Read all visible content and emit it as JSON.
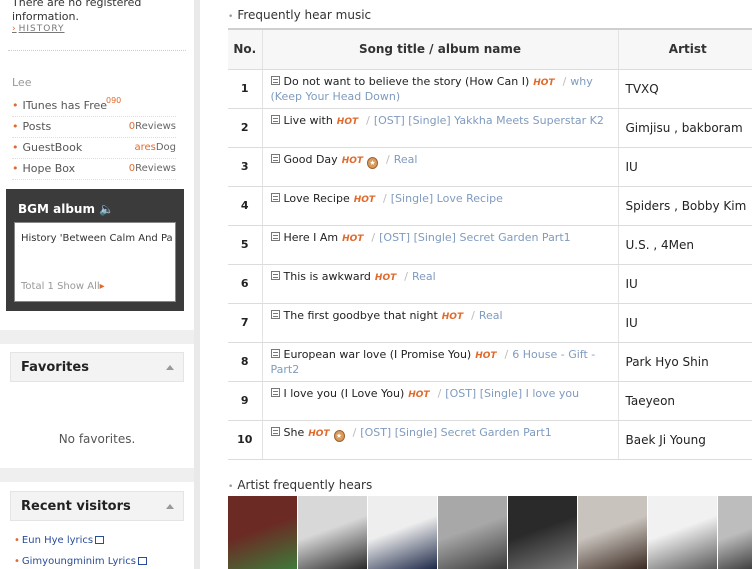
{
  "sidebar": {
    "notice": "There are no registered information.",
    "history_link": "HISTORY",
    "owner": "Lee",
    "menu": [
      {
        "label": "ITunes has Free",
        "count_prefix": "",
        "count_word": "",
        "overflow": "090"
      },
      {
        "label": "Posts",
        "count_prefix": "0",
        "count_word": "Reviews"
      },
      {
        "label": "GuestBook",
        "count_prefix": "ares",
        "count_word": "Dog"
      },
      {
        "label": "Hope Box",
        "count_prefix": "0",
        "count_word": "Reviews"
      }
    ],
    "bgm": {
      "title": "BGM album",
      "speaker_icon": "speaker-icon",
      "song": "History 'Between Calm And Pa",
      "total": "Total 1 Show All"
    },
    "favorites": {
      "title": "Favorites",
      "empty_text": "No favorites."
    },
    "recent_visitors": {
      "title": "Recent visitors",
      "items": [
        "Eun Hye lyrics",
        "Gimyoungminim Lyrics"
      ]
    }
  },
  "main": {
    "music_title": "Frequently hear music",
    "columns": {
      "no": "No.",
      "song": "Song title / album name",
      "artist": "Artist"
    },
    "hot_label": "HOT",
    "rows": [
      {
        "no": "1",
        "song": "Do not want to believe the story (How Can I)",
        "medal": false,
        "album": "why (Keep Your Head Down)",
        "artist": "TVXQ"
      },
      {
        "no": "2",
        "song": "Live with",
        "medal": false,
        "album": "[OST] [Single] Yakkha Meets Superstar K2",
        "artist": "Gimjisu , bakboram"
      },
      {
        "no": "3",
        "song": "Good Day",
        "medal": true,
        "album": "Real",
        "artist": "IU"
      },
      {
        "no": "4",
        "song": "Love Recipe",
        "medal": false,
        "album": "[Single] Love Recipe",
        "artist": "Spiders , Bobby Kim"
      },
      {
        "no": "5",
        "song": "Here I Am",
        "medal": false,
        "album": "[OST] [Single] Secret Garden Part1",
        "artist": "U.S. , 4Men"
      },
      {
        "no": "6",
        "song": "This is awkward",
        "medal": false,
        "album": "Real",
        "artist": "IU"
      },
      {
        "no": "7",
        "song": "The first goodbye that night",
        "medal": false,
        "album": "Real",
        "artist": "IU"
      },
      {
        "no": "8",
        "song": "European war love (I Promise You)",
        "medal": false,
        "album": "6 House - Gift - Part2",
        "artist": "Park Hyo Shin"
      },
      {
        "no": "9",
        "song": "I love you (I Love You)",
        "medal": false,
        "album": "[OST] [Single] I love you",
        "artist": "Taeyeon"
      },
      {
        "no": "10",
        "song": "She",
        "medal": true,
        "album": "[OST] [Single] Secret Garden Part1",
        "artist": "Baek Ji Young"
      }
    ],
    "artist_title": "Artist frequently hears",
    "artist_photos": [
      {
        "bg": "#6b2a24",
        "accent": "#3f7a3a"
      },
      {
        "bg": "#d8d8d8",
        "accent": "#2a2a2a"
      },
      {
        "bg": "#eeeeee",
        "accent": "#1e2a4a"
      },
      {
        "bg": "#a8a8a8",
        "accent": "#3a3a3a"
      },
      {
        "bg": "#2a2a2a",
        "accent": "#7a7a7a"
      },
      {
        "bg": "#c9c3bd",
        "accent": "#3a2a22"
      },
      {
        "bg": "#f1f1f1",
        "accent": "#5a5a5a"
      },
      {
        "bg": "#bdbdbd",
        "accent": "#1a1a1a"
      }
    ]
  }
}
